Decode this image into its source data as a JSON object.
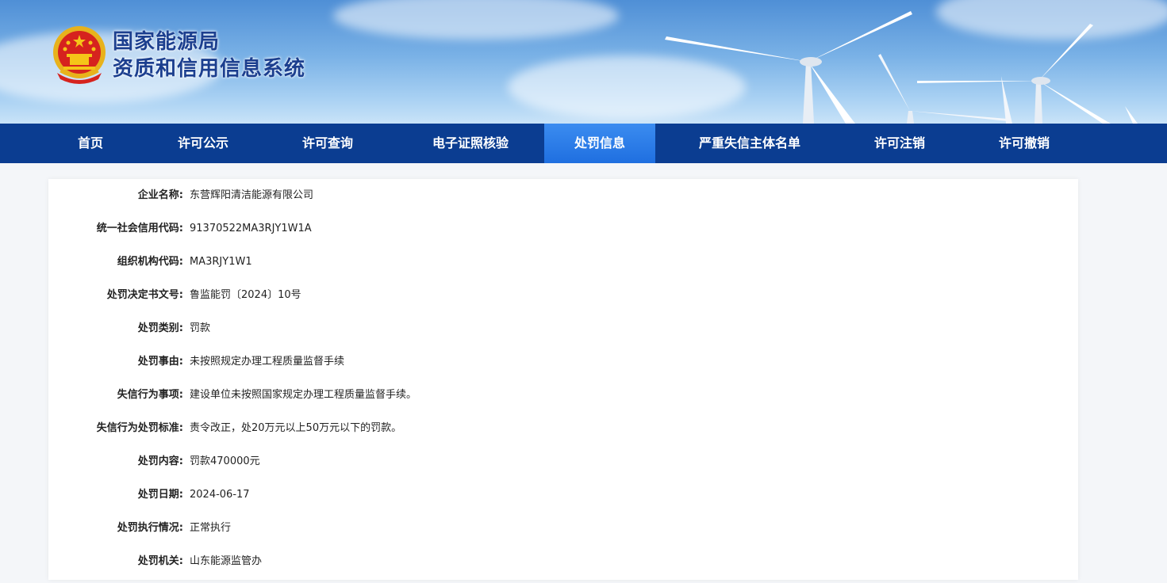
{
  "header": {
    "title_line1": "国家能源局",
    "title_line2": "资质和信用信息系统"
  },
  "nav": {
    "items": [
      {
        "label": "首页",
        "active": false
      },
      {
        "label": "许可公示",
        "active": false
      },
      {
        "label": "许可查询",
        "active": false
      },
      {
        "label": "电子证照核验",
        "active": false
      },
      {
        "label": "处罚信息",
        "active": true
      },
      {
        "label": "严重失信主体名单",
        "active": false
      },
      {
        "label": "许可注销",
        "active": false
      },
      {
        "label": "许可撤销",
        "active": false
      }
    ]
  },
  "details": {
    "rows": [
      {
        "label": "企业名称:",
        "value": "东营辉阳清洁能源有限公司"
      },
      {
        "label": "统一社会信用代码:",
        "value": "91370522MA3RJY1W1A"
      },
      {
        "label": "组织机构代码:",
        "value": "MA3RJY1W1"
      },
      {
        "label": "处罚决定书文号:",
        "value": "鲁监能罚〔2024〕10号"
      },
      {
        "label": "处罚类别:",
        "value": "罚款"
      },
      {
        "label": "处罚事由:",
        "value": "未按照规定办理工程质量监督手续"
      },
      {
        "label": "失信行为事项:",
        "value": "建设单位未按照国家规定办理工程质量监督手续。"
      },
      {
        "label": "失信行为处罚标准:",
        "value": "责令改正，处20万元以上50万元以下的罚款。"
      },
      {
        "label": "处罚内容:",
        "value": "罚款470000元"
      },
      {
        "label": "处罚日期:",
        "value": "2024-06-17"
      },
      {
        "label": "处罚执行情况:",
        "value": "正常执行"
      },
      {
        "label": "处罚机关:",
        "value": "山东能源监管办"
      }
    ]
  },
  "colors": {
    "nav_bg": "#0b3d91",
    "nav_active": "#2a7de9",
    "title": "#1c3f8f"
  },
  "icons": {
    "emblem": "national-emblem-icon"
  }
}
